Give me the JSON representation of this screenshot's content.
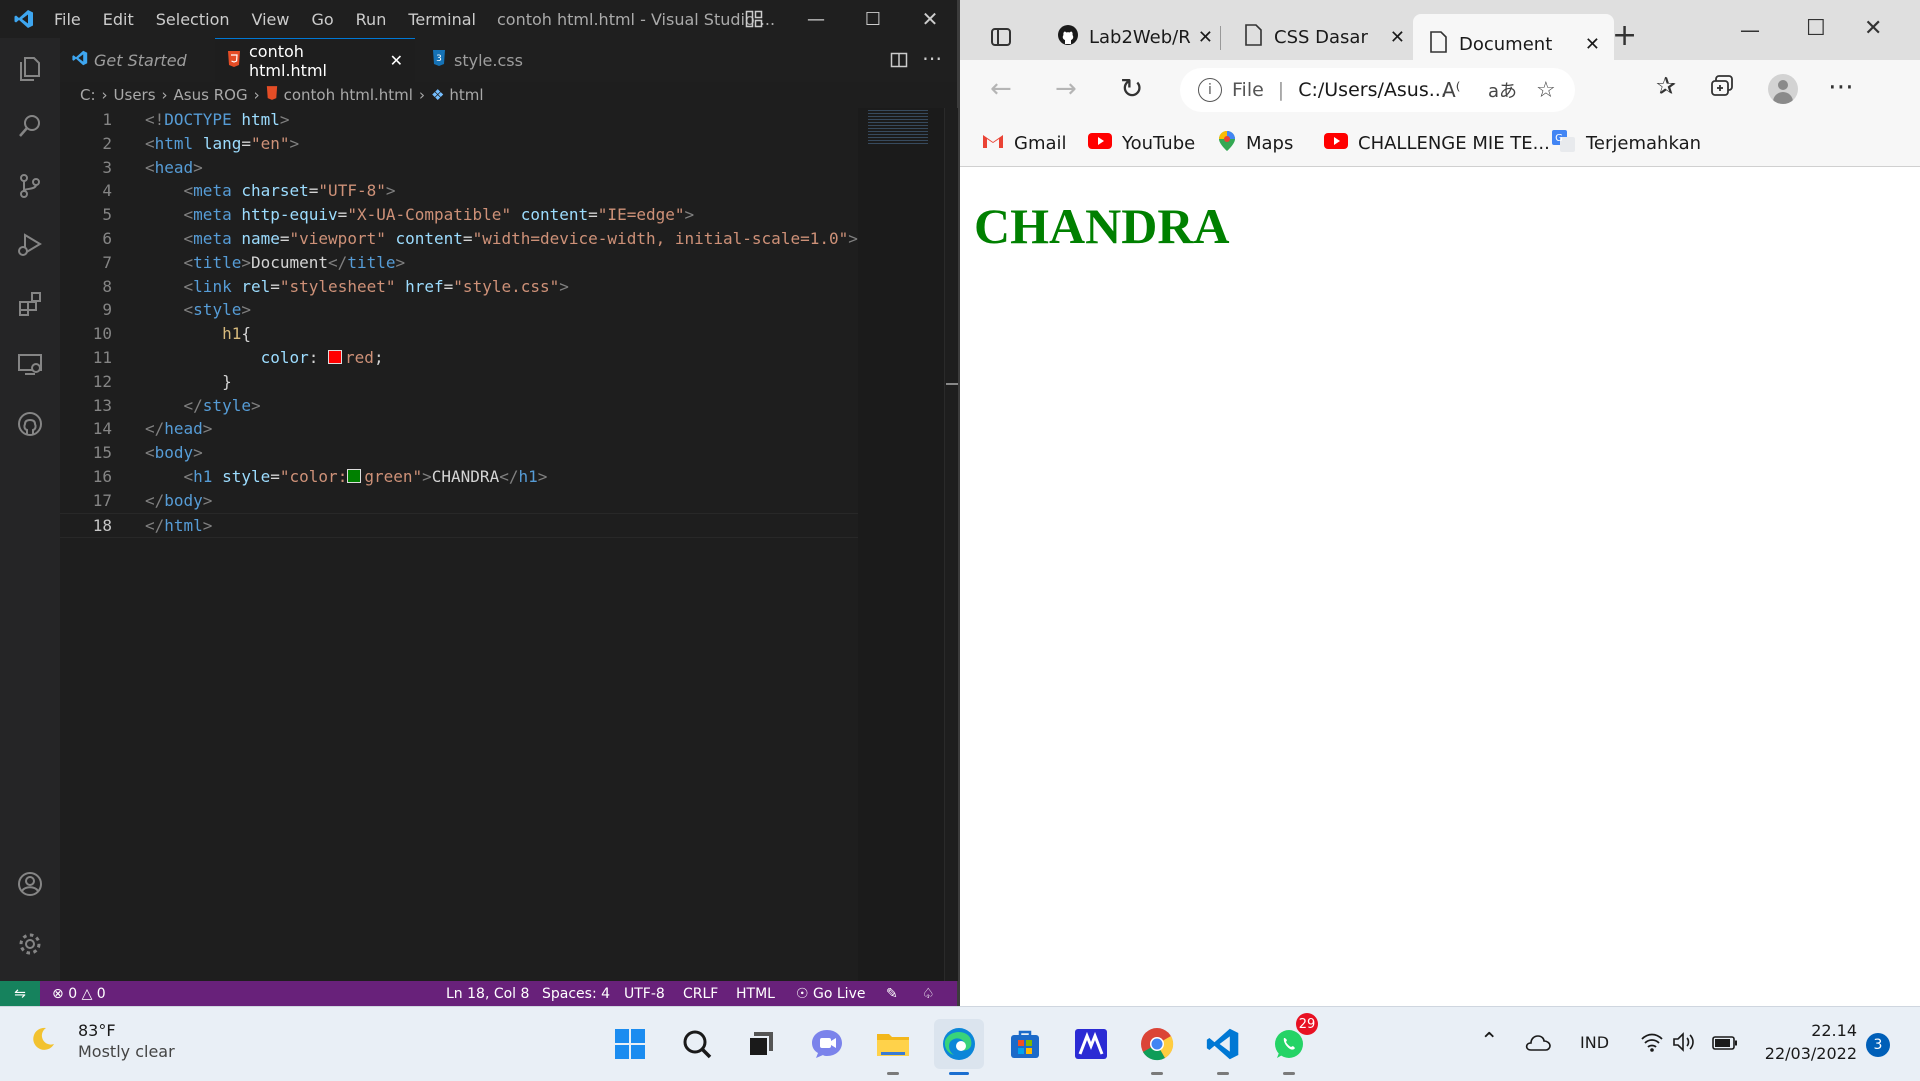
{
  "vscode": {
    "menu": [
      "File",
      "Edit",
      "Selection",
      "View",
      "Go",
      "Run",
      "Terminal"
    ],
    "window_title": "contoh html.html - Visual Studio ...",
    "tabs": [
      {
        "label": "Get Started"
      },
      {
        "label": "contoh html.html"
      },
      {
        "label": "style.css"
      }
    ],
    "breadcrumb": [
      "C:",
      "Users",
      "Asus ROG",
      "contoh html.html",
      "html"
    ],
    "code": [
      {
        "n": "1",
        "parts": [
          [
            "tg",
            "<!"
          ],
          [
            "tn",
            "DOCTYPE"
          ],
          [
            "tx",
            " "
          ],
          [
            "at",
            "html"
          ],
          [
            "tg",
            ">"
          ]
        ]
      },
      {
        "n": "2",
        "parts": [
          [
            "tg",
            "<"
          ],
          [
            "tn",
            "html"
          ],
          [
            "tx",
            " "
          ],
          [
            "at",
            "lang"
          ],
          [
            "tx",
            "="
          ],
          [
            "sv",
            "\"en\""
          ],
          [
            "tg",
            ">"
          ]
        ]
      },
      {
        "n": "3",
        "parts": [
          [
            "tg",
            "<"
          ],
          [
            "tn",
            "head"
          ],
          [
            "tg",
            ">"
          ]
        ]
      },
      {
        "n": "4",
        "parts": [
          [
            "tx",
            "    "
          ],
          [
            "tg",
            "<"
          ],
          [
            "tn",
            "meta"
          ],
          [
            "tx",
            " "
          ],
          [
            "at",
            "charset"
          ],
          [
            "tx",
            "="
          ],
          [
            "sv",
            "\"UTF-8\""
          ],
          [
            "tg",
            ">"
          ]
        ]
      },
      {
        "n": "5",
        "parts": [
          [
            "tx",
            "    "
          ],
          [
            "tg",
            "<"
          ],
          [
            "tn",
            "meta"
          ],
          [
            "tx",
            " "
          ],
          [
            "at",
            "http-equiv"
          ],
          [
            "tx",
            "="
          ],
          [
            "sv",
            "\"X-UA-Compatible\""
          ],
          [
            "tx",
            " "
          ],
          [
            "at",
            "content"
          ],
          [
            "tx",
            "="
          ],
          [
            "sv",
            "\"IE=edge\""
          ],
          [
            "tg",
            ">"
          ]
        ]
      },
      {
        "n": "6",
        "parts": [
          [
            "tx",
            "    "
          ],
          [
            "tg",
            "<"
          ],
          [
            "tn",
            "meta"
          ],
          [
            "tx",
            " "
          ],
          [
            "at",
            "name"
          ],
          [
            "tx",
            "="
          ],
          [
            "sv",
            "\"viewport\""
          ],
          [
            "tx",
            " "
          ],
          [
            "at",
            "content"
          ],
          [
            "tx",
            "="
          ],
          [
            "sv",
            "\"width=device-width, initial-scale=1.0\""
          ],
          [
            "tg",
            ">"
          ]
        ]
      },
      {
        "n": "7",
        "parts": [
          [
            "tx",
            "    "
          ],
          [
            "tg",
            "<"
          ],
          [
            "tn",
            "title"
          ],
          [
            "tg",
            ">"
          ],
          [
            "tx",
            "Document"
          ],
          [
            "tg",
            "</"
          ],
          [
            "tn",
            "title"
          ],
          [
            "tg",
            ">"
          ]
        ]
      },
      {
        "n": "8",
        "parts": [
          [
            "tx",
            "    "
          ],
          [
            "tg",
            "<"
          ],
          [
            "tn",
            "link"
          ],
          [
            "tx",
            " "
          ],
          [
            "at",
            "rel"
          ],
          [
            "tx",
            "="
          ],
          [
            "sv",
            "\"stylesheet\""
          ],
          [
            "tx",
            " "
          ],
          [
            "at",
            "href"
          ],
          [
            "tx",
            "="
          ],
          [
            "sv",
            "\"style.css\""
          ],
          [
            "tg",
            ">"
          ]
        ]
      },
      {
        "n": "9",
        "parts": [
          [
            "tx",
            "    "
          ],
          [
            "tg",
            "<"
          ],
          [
            "tn",
            "style"
          ],
          [
            "tg",
            ">"
          ]
        ]
      },
      {
        "n": "10",
        "parts": [
          [
            "tx",
            "        "
          ],
          [
            "sel",
            "h1"
          ],
          [
            "tx",
            "{"
          ]
        ]
      },
      {
        "n": "11",
        "parts": [
          [
            "tx",
            "            "
          ],
          [
            "at",
            "color"
          ],
          [
            "tx",
            ": "
          ],
          [
            "swatch",
            "#ff0000"
          ],
          [
            "sv",
            "red"
          ],
          [
            "tx",
            ";"
          ]
        ]
      },
      {
        "n": "12",
        "parts": [
          [
            "tx",
            "        }"
          ]
        ]
      },
      {
        "n": "13",
        "parts": [
          [
            "tx",
            "    "
          ],
          [
            "tg",
            "</"
          ],
          [
            "tn",
            "style"
          ],
          [
            "tg",
            ">"
          ]
        ]
      },
      {
        "n": "14",
        "parts": [
          [
            "tg",
            "</"
          ],
          [
            "tn",
            "head"
          ],
          [
            "tg",
            ">"
          ]
        ]
      },
      {
        "n": "15",
        "parts": [
          [
            "tg",
            "<"
          ],
          [
            "tn",
            "body"
          ],
          [
            "tg",
            ">"
          ]
        ]
      },
      {
        "n": "16",
        "parts": [
          [
            "tx",
            "    "
          ],
          [
            "tg",
            "<"
          ],
          [
            "tn",
            "h1"
          ],
          [
            "tx",
            " "
          ],
          [
            "at",
            "style"
          ],
          [
            "tx",
            "="
          ],
          [
            "sv",
            "\"color:"
          ],
          [
            "swatch",
            "#008000"
          ],
          [
            "sv",
            "green\""
          ],
          [
            "tg",
            ">"
          ],
          [
            "tx",
            "CHANDRA"
          ],
          [
            "tg",
            "</"
          ],
          [
            "tn",
            "h1"
          ],
          [
            "tg",
            ">"
          ]
        ]
      },
      {
        "n": "17",
        "parts": [
          [
            "tg",
            "</"
          ],
          [
            "tn",
            "body"
          ],
          [
            "tg",
            ">"
          ]
        ]
      },
      {
        "n": "18",
        "parts": [
          [
            "tg",
            "</"
          ],
          [
            "tn",
            "html"
          ],
          [
            "tg",
            ">"
          ]
        ]
      }
    ],
    "status": {
      "errors": "0",
      "warnings": "0",
      "position": "Ln 18, Col 8",
      "spaces": "Spaces: 4",
      "encoding": "UTF-8",
      "eol": "CRLF",
      "language": "HTML",
      "golive": "Go Live"
    }
  },
  "browser": {
    "tabs": [
      {
        "label": "Lab2Web/R"
      },
      {
        "label": "CSS Dasar"
      },
      {
        "label": "Document"
      }
    ],
    "address_prefix": "File",
    "address": "C:/Users/Asus...",
    "favorites": [
      {
        "label": "Gmail"
      },
      {
        "label": "YouTube"
      },
      {
        "label": "Maps"
      },
      {
        "label": "CHALLENGE MIE TE..."
      },
      {
        "label": "Terjemahkan"
      }
    ],
    "page_heading": "CHANDRA"
  },
  "taskbar": {
    "weather_temp": "83°F",
    "weather_desc": "Mostly clear",
    "whatsapp_badge": "29",
    "language": "IND",
    "time": "22.14",
    "date": "22/03/2022",
    "notifications": "3"
  }
}
